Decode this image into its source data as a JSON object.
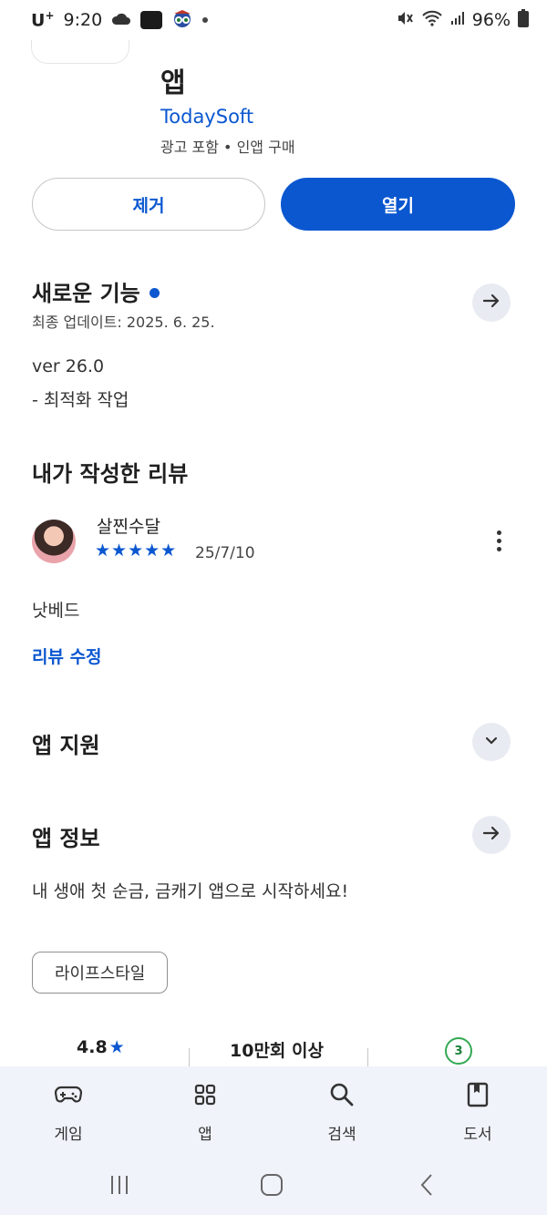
{
  "status_bar": {
    "carrier": "U",
    "carrier_sup": "+",
    "time": "9:20",
    "battery": "96%"
  },
  "app": {
    "title_line2": "앱",
    "developer": "TodaySoft",
    "meta": "광고 포함 • 인앱 구매",
    "remove_label": "제거",
    "open_label": "열기"
  },
  "whats_new": {
    "title": "새로운 기능",
    "updated": "최종 업데이트: 2025. 6. 25.",
    "version": "ver 26.0",
    "notes": "- 최적화 작업"
  },
  "my_review": {
    "title": "내가 작성한 리뷰",
    "reviewer": "살찐수달",
    "stars": "★★★★★",
    "date": "25/7/10",
    "text": "낫베드",
    "edit_label": "리뷰 수정"
  },
  "app_support": {
    "title": "앱 지원"
  },
  "app_info": {
    "title": "앱 정보",
    "description": "내 생애 첫 순금, 금캐기 앱으로 시작하세요!",
    "category": "라이프스타일"
  },
  "stats": {
    "rating": "4.8",
    "rating_star": "★",
    "downloads": "10만회 이상",
    "content_rating": "3"
  },
  "bottom_nav": [
    {
      "label": "게임",
      "icon": "gamepad-icon"
    },
    {
      "label": "앱",
      "icon": "apps-grid-icon"
    },
    {
      "label": "검색",
      "icon": "search-icon"
    },
    {
      "label": "도서",
      "icon": "book-icon"
    }
  ],
  "colors": {
    "accent": "#0b57d0",
    "nav_bg": "#f0f3fa",
    "chip_bg": "#e9ebf2"
  }
}
